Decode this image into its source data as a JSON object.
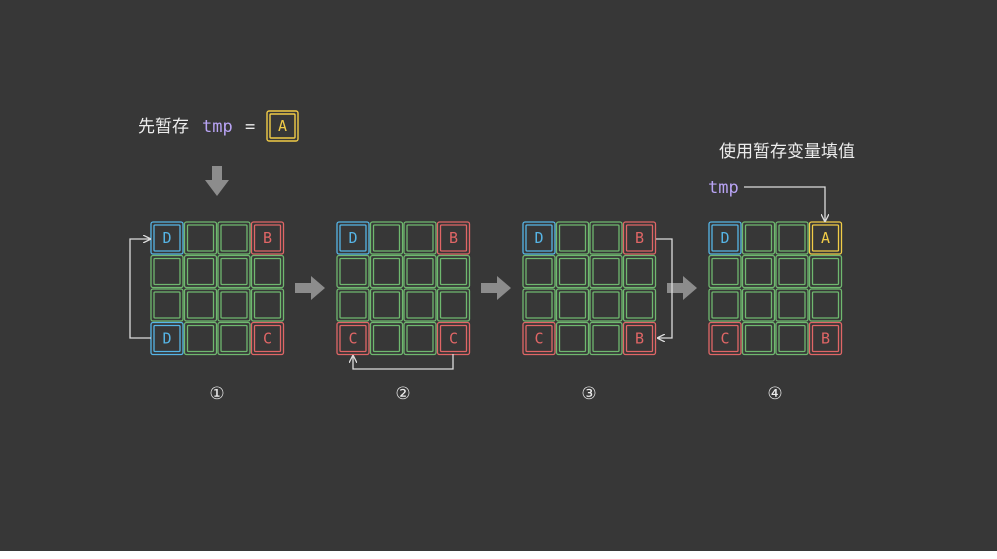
{
  "header_label": "先暂存",
  "tmp_var": "tmp",
  "equals": "=",
  "tmp_value": "A",
  "fill_label": "使用暂存变量填值",
  "fill_var": "tmp",
  "steps": [
    "①",
    "②",
    "③",
    "④"
  ],
  "colors": {
    "background": "#373737",
    "green": "#6fb86f",
    "blue": "#56b5e6",
    "red": "#e06666",
    "yellow": "#f1cc47",
    "tmp_text": "#b9a4f5",
    "arrow": "#8c8c8c",
    "line": "#dcdcdc"
  },
  "grids": [
    {
      "corners": {
        "tl": "D",
        "tr": "B",
        "bl": "D",
        "br": "C"
      }
    },
    {
      "corners": {
        "tl": "D",
        "tr": "B",
        "bl": "C",
        "br": "C"
      }
    },
    {
      "corners": {
        "tl": "D",
        "tr": "B",
        "bl": "C",
        "br": "B"
      }
    },
    {
      "corners": {
        "tl": "D",
        "tr": "A",
        "bl": "C",
        "br": "B"
      }
    }
  ]
}
